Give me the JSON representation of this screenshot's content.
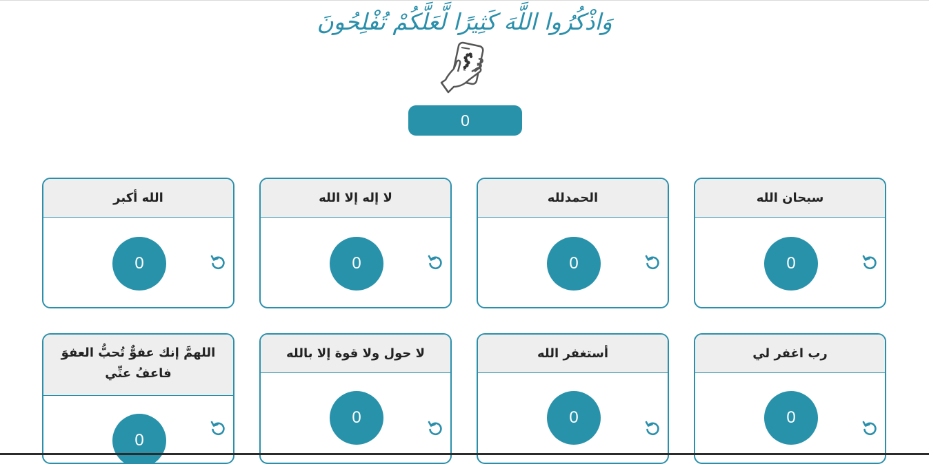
{
  "header": {
    "verse": "وَاذْكُرُوا اللَّهَ كَثِيرًا لَّعَلَّكُمْ تُفْلِحُونَ",
    "icon": "hand-phone-tasbih-icon",
    "total_count": "0"
  },
  "colors": {
    "accent": "#2892ab",
    "card_border": "#2a8fab",
    "header_bg": "#eeeeee"
  },
  "cards": [
    {
      "title": "سبحان الله",
      "count": "0",
      "reset_icon": "reset-icon"
    },
    {
      "title": "الحمدلله",
      "count": "0",
      "reset_icon": "reset-icon"
    },
    {
      "title": "لا إله إلا الله",
      "count": "0",
      "reset_icon": "reset-icon"
    },
    {
      "title": "الله أكبر",
      "count": "0",
      "reset_icon": "reset-icon"
    },
    {
      "title": "رب اغفر لي",
      "count": "0",
      "reset_icon": "reset-icon"
    },
    {
      "title": "أستغفر الله",
      "count": "0",
      "reset_icon": "reset-icon"
    },
    {
      "title": "لا حول ولا قوة إلا بالله",
      "count": "0",
      "reset_icon": "reset-icon"
    },
    {
      "title": "اللهمَّ إنك عفوٌّ تُحبُّ العفوَ فاعفُ عنِّي",
      "count": "0",
      "reset_icon": "reset-icon"
    }
  ]
}
